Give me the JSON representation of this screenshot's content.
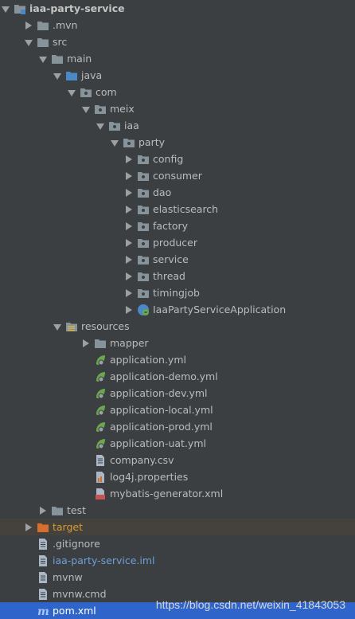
{
  "tree": {
    "root": "iaa-party-service",
    "mvn": ".mvn",
    "src": "src",
    "main": "main",
    "java": "java",
    "com": "com",
    "meix": "meix",
    "iaa": "iaa",
    "party": "party",
    "packages": [
      "config",
      "consumer",
      "dao",
      "elasticsearch",
      "factory",
      "producer",
      "service",
      "thread",
      "timingjob"
    ],
    "app_class": "IaaPartyServiceApplication",
    "resources": "resources",
    "mapper": "mapper",
    "yml_files": [
      "application.yml",
      "application-demo.yml",
      "application-dev.yml",
      "application-local.yml",
      "application-prod.yml",
      "application-uat.yml"
    ],
    "company_csv": "company.csv",
    "log4j": "log4j.properties",
    "mybatis": "mybatis-generator.xml",
    "test": "test",
    "target": "target",
    "gitignore": ".gitignore",
    "iml": "iaa-party-service.iml",
    "mvnw": "mvnw",
    "mvnw_cmd": "mvnw.cmd",
    "pom": "pom.xml"
  },
  "watermark": "https://blog.csdn.net/weixin_41843053",
  "colors": {
    "background": "#3c3f41",
    "selection": "#2f65ca",
    "excluded_row": "#45423d",
    "folder": "#87939a",
    "source_folder": "#4a88c7",
    "excluded_folder": "#d46f2e",
    "spring": "#6aa84f"
  }
}
